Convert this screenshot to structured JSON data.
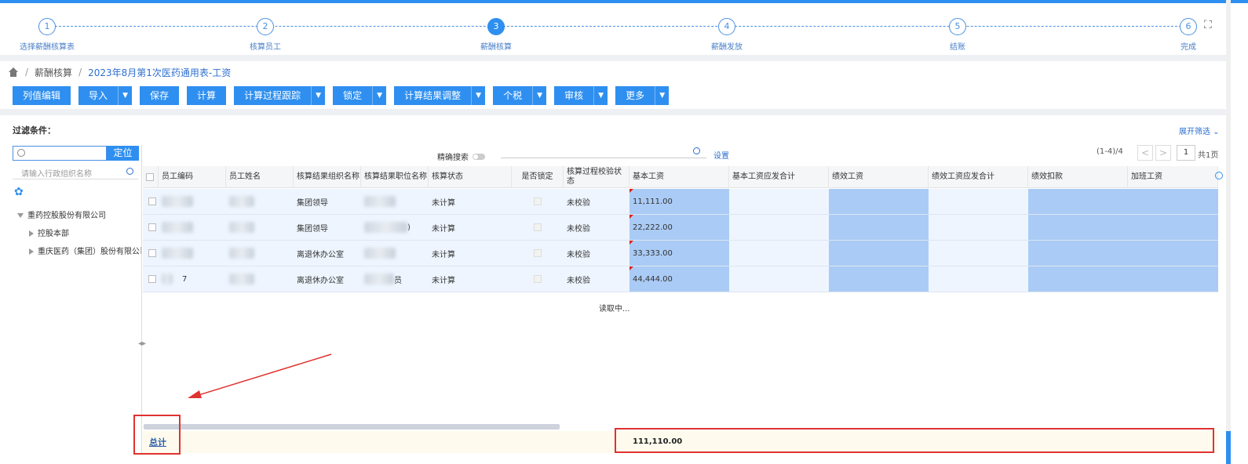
{
  "steps": [
    {
      "num": "1",
      "label": "选择薪酬核算表",
      "active": false
    },
    {
      "num": "2",
      "label": "核算员工",
      "active": false
    },
    {
      "num": "3",
      "label": "薪酬核算",
      "active": true
    },
    {
      "num": "4",
      "label": "薪酬发放",
      "active": false
    },
    {
      "num": "5",
      "label": "结账",
      "active": false
    },
    {
      "num": "6",
      "label": "完成",
      "active": false
    }
  ],
  "breadcrumb": {
    "level1": "薪酬核算",
    "level2": "2023年8月第1次医药通用表-工资",
    "separator": "/"
  },
  "toolbar": {
    "buttons": [
      {
        "label": "列值编辑",
        "dropdown": false
      },
      {
        "label": "导入",
        "dropdown": true
      },
      {
        "label": "保存",
        "dropdown": false
      },
      {
        "label": "计算",
        "dropdown": false
      },
      {
        "label": "计算过程跟踪",
        "dropdown": true
      },
      {
        "label": "锁定",
        "dropdown": true
      },
      {
        "label": "计算结果调整",
        "dropdown": true
      },
      {
        "label": "个税",
        "dropdown": true
      },
      {
        "label": "审核",
        "dropdown": true
      },
      {
        "label": "更多",
        "dropdown": true
      }
    ]
  },
  "filter": {
    "label": "过滤条件：",
    "expand": "展开筛选 ⌄"
  },
  "tree": {
    "locate": "定位",
    "org_placeholder": "请输入行政组织名称",
    "root": "重药控股股份有限公司",
    "children": [
      "控股本部",
      "重庆医药（集团）股份有限公司"
    ]
  },
  "grid_tools": {
    "precise": "精确搜索",
    "settings": "设置",
    "page_info": "(1-4)/4",
    "page": "1",
    "total_pages": "共1页",
    "prev": "<",
    "next": ">"
  },
  "columns": [
    "员工编码",
    "员工姓名",
    "核算结果组织名称",
    "核算结果职位名称",
    "核算状态",
    "是否锁定",
    "核算过程校验状态",
    "基本工资",
    "基本工资应发合计",
    "绩效工资",
    "绩效工资应发合计",
    "绩效扣款",
    "加班工资"
  ],
  "rows": [
    {
      "code": "",
      "name": "",
      "org": "集团领导",
      "pos": "",
      "status": "未计算",
      "check": "未校验",
      "base": "11,111.00"
    },
    {
      "code": "",
      "name": "",
      "org": "集团领导",
      "pos": ")",
      "status": "未计算",
      "check": "未校验",
      "base": "22,222.00"
    },
    {
      "code": "",
      "name": "",
      "org": "离退休办公室",
      "pos": "",
      "status": "未计算",
      "check": "未校验",
      "base": "33,333.00"
    },
    {
      "code": "7",
      "name": "",
      "org": "离退休办公室",
      "pos": "员",
      "status": "未计算",
      "check": "未校验",
      "base": "44,444.00"
    }
  ],
  "loading": "读取中...",
  "footer": {
    "total_label": "总计",
    "total_base": "111,110.00"
  },
  "colors": {
    "accent": "#2e8ff0",
    "highlight": "#aacbf5",
    "annotation": "#e0322f"
  }
}
